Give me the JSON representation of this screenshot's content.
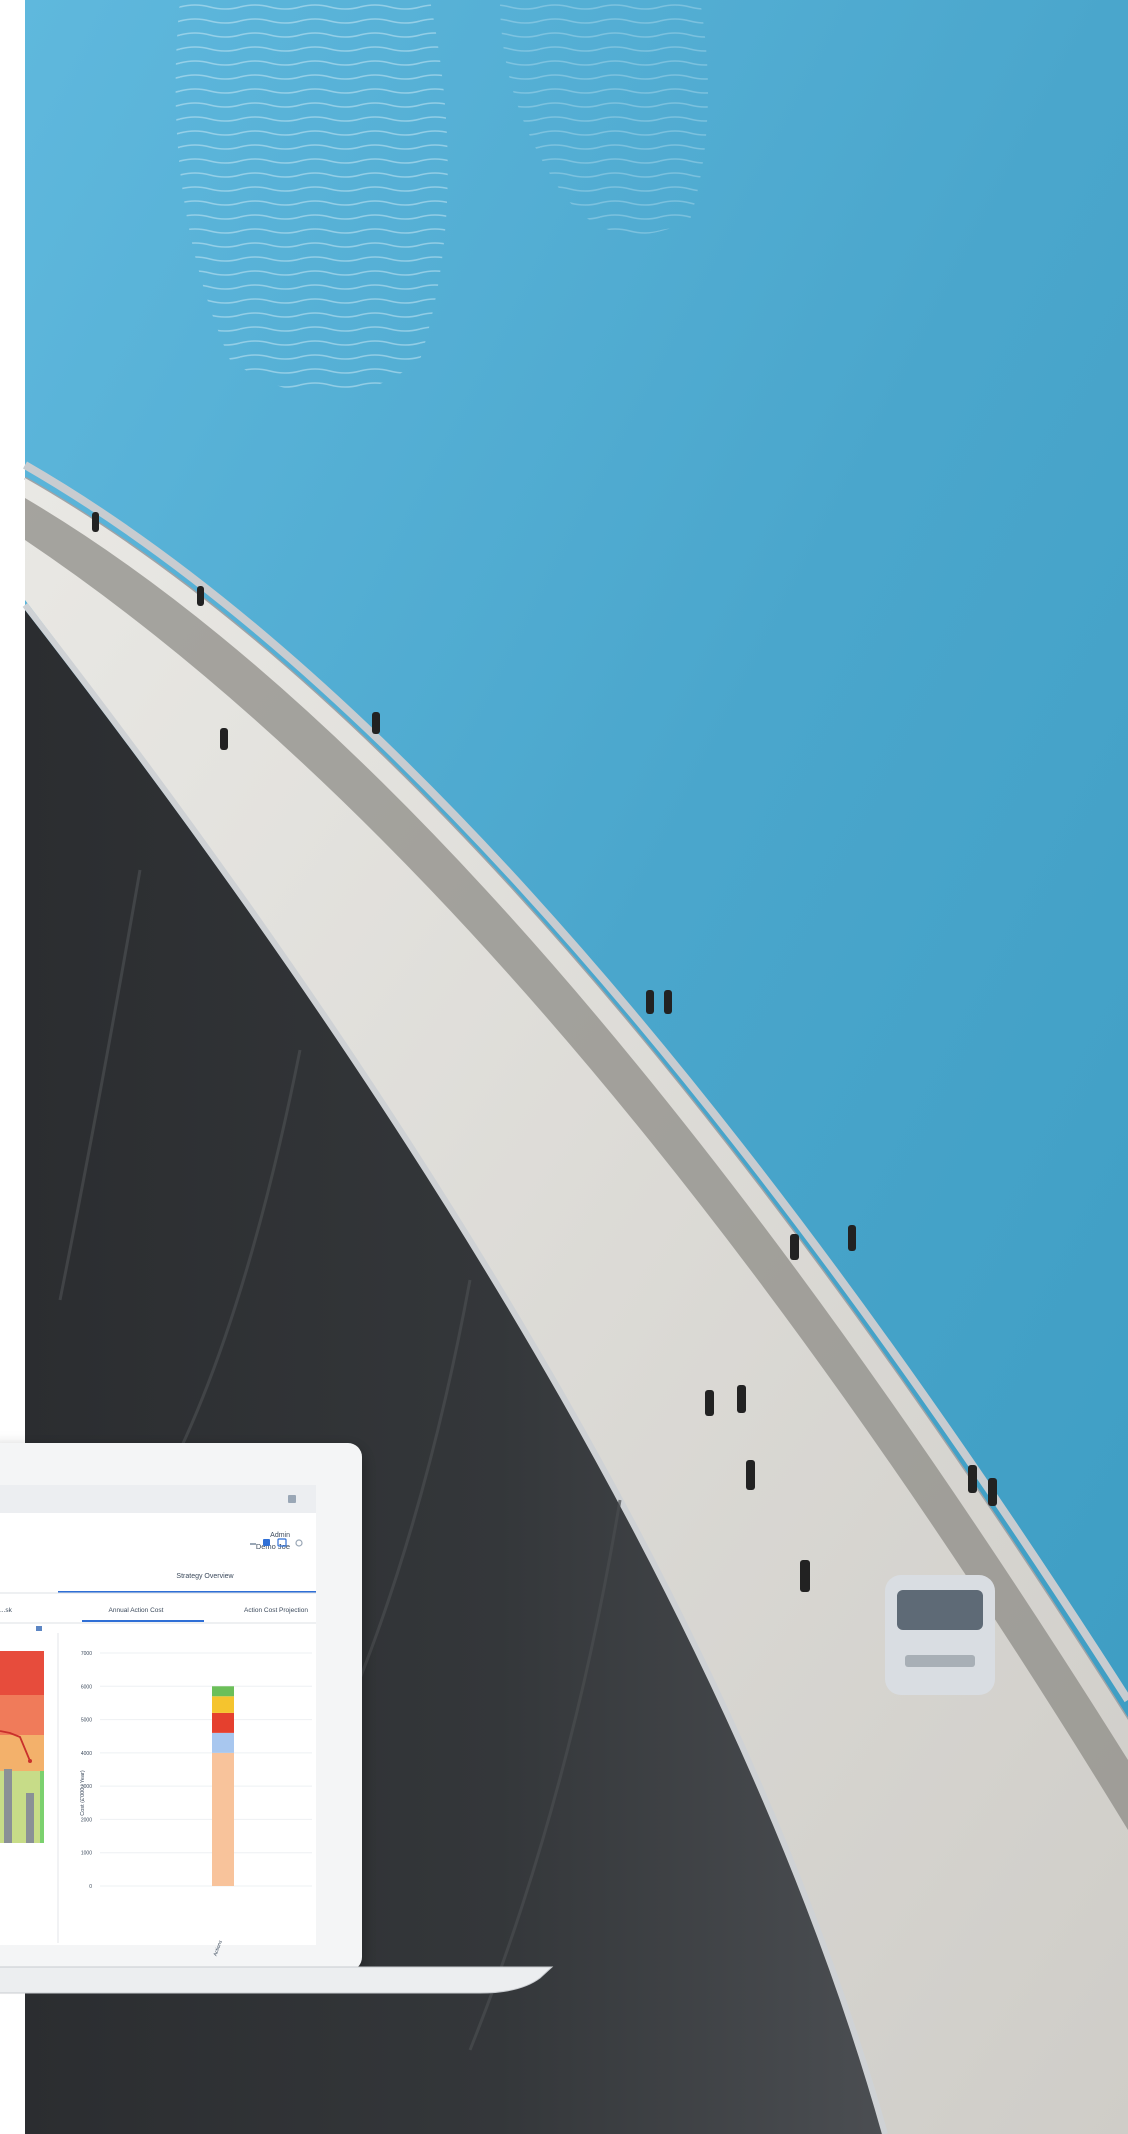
{
  "header": {
    "user_role": "Admin",
    "user_name": "Demo Joe"
  },
  "tabs": {
    "group_title": "Strategy Overview",
    "items": [
      {
        "label": "...sk"
      },
      {
        "label": "Annual Action Cost"
      },
      {
        "label": "Action Cost Projection"
      }
    ]
  },
  "chart_data": {
    "type": "bar",
    "title": "",
    "ylabel": "Cost (£'000 / Year)",
    "ylim": [
      0,
      7000
    ],
    "yticks": [
      "7000",
      "6000",
      "5000",
      "4000",
      "3000",
      "2000",
      "1000",
      "0"
    ],
    "categories": [
      "Actions"
    ],
    "series": [
      {
        "values": [
          4000
        ],
        "color": "#f8c39b"
      },
      {
        "values": [
          600
        ],
        "color": "#a8c7ef"
      },
      {
        "values": [
          600
        ],
        "color": "#e5402e"
      },
      {
        "values": [
          500
        ],
        "color": "#f5c42e"
      },
      {
        "values": [
          300
        ],
        "color": "#6bbf59"
      }
    ]
  },
  "colors": {
    "sky_water": "#4aa6cc",
    "dam_face": "#35383b",
    "accent_blue": "#2f6fd6"
  }
}
